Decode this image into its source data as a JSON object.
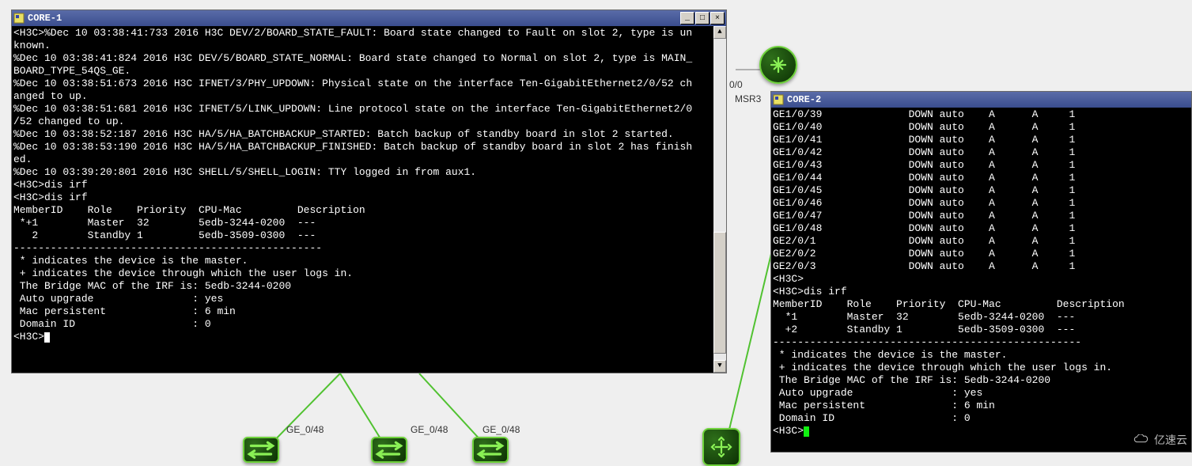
{
  "window1": {
    "title": "CORE-1",
    "prompt": "<H3C>",
    "cmd_dis_irf": "dis irf",
    "log_lines": [
      "<H3C>%Dec 10 03:38:41:733 2016 H3C DEV/2/BOARD_STATE_FAULT: Board state changed to Fault on slot 2, type is un",
      "known.",
      "%Dec 10 03:38:41:824 2016 H3C DEV/5/BOARD_STATE_NORMAL: Board state changed to Normal on slot 2, type is MAIN_",
      "BOARD_TYPE_54QS_GE.",
      "%Dec 10 03:38:51:673 2016 H3C IFNET/3/PHY_UPDOWN: Physical state on the interface Ten-GigabitEthernet2/0/52 ch",
      "anged to up.",
      "%Dec 10 03:38:51:681 2016 H3C IFNET/5/LINK_UPDOWN: Line protocol state on the interface Ten-GigabitEthernet2/0",
      "/52 changed to up.",
      "%Dec 10 03:38:52:187 2016 H3C HA/5/HA_BATCHBACKUP_STARTED: Batch backup of standby board in slot 2 started.",
      "%Dec 10 03:38:53:190 2016 H3C HA/5/HA_BATCHBACKUP_FINISHED: Batch backup of standby board in slot 2 has finish",
      "ed.",
      "%Dec 10 03:39:20:801 2016 H3C SHELL/5/SHELL_LOGIN: TTY logged in from aux1."
    ],
    "irf_header": "MemberID    Role    Priority  CPU-Mac         Description",
    "irf_rows": [
      " *+1        Master  32        5edb-3244-0200  ---",
      "   2        Standby 1         5edb-3509-0300  ---"
    ],
    "dashes": "--------------------------------------------------",
    "note_master": " * indicates the device is the master.",
    "note_login": " + indicates the device through which the user logs in.",
    "bridge_mac": " The Bridge MAC of the IRF is: 5edb-3244-0200",
    "auto_upgrade": " Auto upgrade                : yes",
    "mac_persist": " Mac persistent              : 6 min",
    "domain_id": " Domain ID                   : 0"
  },
  "window2": {
    "title": "CORE-2",
    "prompt": "<H3C>",
    "cmd_dis_irf": "dis irf",
    "iface_rows": [
      {
        "if": "GE1/0/39",
        "status": "DOWN",
        "speed": "auto",
        "a1": "A",
        "a2": "A",
        "n": "1"
      },
      {
        "if": "GE1/0/40",
        "status": "DOWN",
        "speed": "auto",
        "a1": "A",
        "a2": "A",
        "n": "1"
      },
      {
        "if": "GE1/0/41",
        "status": "DOWN",
        "speed": "auto",
        "a1": "A",
        "a2": "A",
        "n": "1"
      },
      {
        "if": "GE1/0/42",
        "status": "DOWN",
        "speed": "auto",
        "a1": "A",
        "a2": "A",
        "n": "1"
      },
      {
        "if": "GE1/0/43",
        "status": "DOWN",
        "speed": "auto",
        "a1": "A",
        "a2": "A",
        "n": "1"
      },
      {
        "if": "GE1/0/44",
        "status": "DOWN",
        "speed": "auto",
        "a1": "A",
        "a2": "A",
        "n": "1"
      },
      {
        "if": "GE1/0/45",
        "status": "DOWN",
        "speed": "auto",
        "a1": "A",
        "a2": "A",
        "n": "1"
      },
      {
        "if": "GE1/0/46",
        "status": "DOWN",
        "speed": "auto",
        "a1": "A",
        "a2": "A",
        "n": "1"
      },
      {
        "if": "GE1/0/47",
        "status": "DOWN",
        "speed": "auto",
        "a1": "A",
        "a2": "A",
        "n": "1"
      },
      {
        "if": "GE1/0/48",
        "status": "DOWN",
        "speed": "auto",
        "a1": "A",
        "a2": "A",
        "n": "1"
      },
      {
        "if": "GE2/0/1",
        "status": "DOWN",
        "speed": "auto",
        "a1": "A",
        "a2": "A",
        "n": "1"
      },
      {
        "if": "GE2/0/2",
        "status": "DOWN",
        "speed": "auto",
        "a1": "A",
        "a2": "A",
        "n": "1"
      },
      {
        "if": "GE2/0/3",
        "status": "DOWN",
        "speed": "auto",
        "a1": "A",
        "a2": "A",
        "n": "1"
      }
    ],
    "irf_header": "MemberID    Role    Priority  CPU-Mac         Description",
    "irf_rows": [
      "  *1        Master  32        5edb-3244-0200  ---",
      "  +2        Standby 1         5edb-3509-0300  ---"
    ],
    "dashes": "--------------------------------------------------",
    "note_master": " * indicates the device is the master.",
    "note_login": " + indicates the device through which the user logs in.",
    "bridge_mac": " The Bridge MAC of the IRF is: 5edb-3244-0200",
    "auto_upgrade": " Auto upgrade                : yes",
    "mac_persist": " Mac persistent              : 6 min",
    "domain_id": " Domain ID                   : 0"
  },
  "topology": {
    "device_label": "MSR3",
    "port_label_00": "0/0",
    "port_ge_0_48": "GE_0/48"
  },
  "watermark": "亿速云"
}
